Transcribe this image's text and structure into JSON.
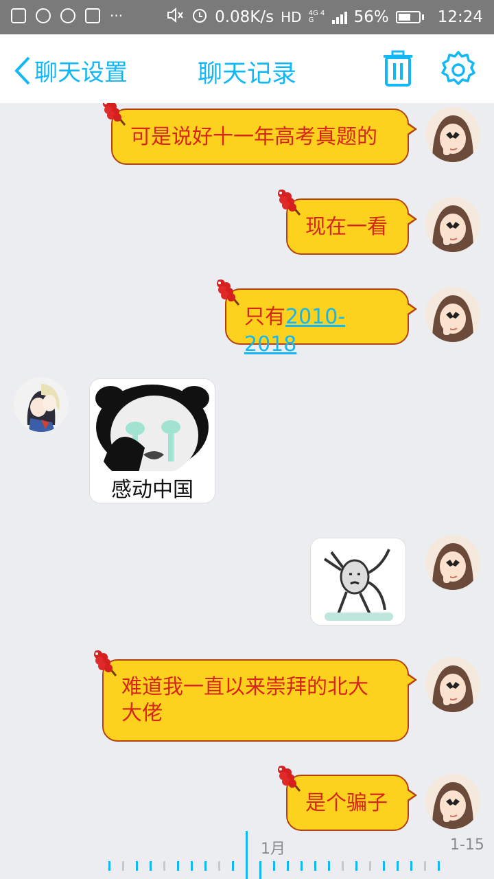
{
  "status_bar": {
    "network_speed": "0.08K/s",
    "hd_label": "HD",
    "network_type": "4G 4G",
    "battery": "56%",
    "time": "12:24"
  },
  "header": {
    "back_label": "聊天设置",
    "title": "聊天记录",
    "icons": [
      "trash-icon",
      "gear-icon"
    ]
  },
  "messages": [
    {
      "side": "me",
      "type": "text",
      "text": "可是说好十一年高考真题的"
    },
    {
      "side": "me",
      "type": "text",
      "text": "现在一看"
    },
    {
      "side": "me",
      "type": "text",
      "text_prefix": "只有",
      "link": "2010-2018"
    },
    {
      "side": "other",
      "type": "sticker",
      "caption": "感动中国"
    },
    {
      "side": "me",
      "type": "sticker"
    },
    {
      "side": "me",
      "type": "text",
      "line1": "难道我一直以来崇拜的北大",
      "line2": "大佬"
    },
    {
      "side": "me",
      "type": "text",
      "text": "是个骗子"
    }
  ],
  "timeline": {
    "month_label": "1月",
    "date_label": "1-15"
  },
  "colors": {
    "accent": "#12b7f5",
    "bubble_fill": "#fcd21f",
    "bubble_text": "#d6261a",
    "bubble_border": "#b24210",
    "background": "#ebedf0"
  }
}
